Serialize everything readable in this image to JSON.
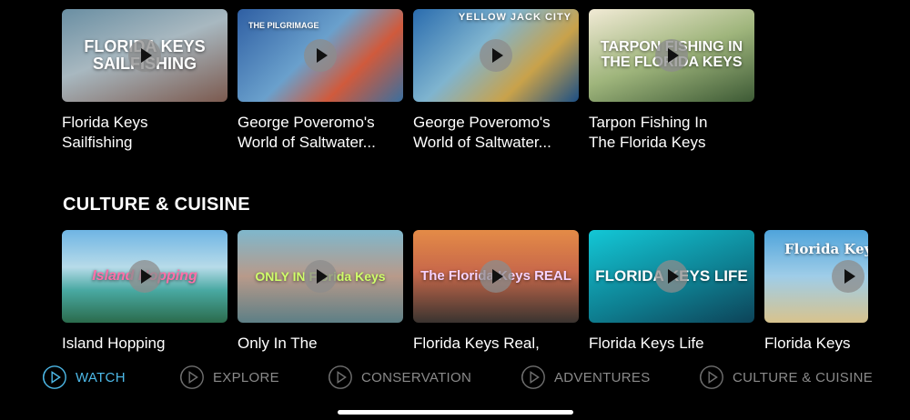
{
  "top_row": [
    {
      "title": "Florida Keys\nSailfishing",
      "thumb_text": "FLORIDA KEYS SAILFISHING"
    },
    {
      "title": "George Poveromo's\nWorld of Saltwater...",
      "thumb_text": "THE PILGRIMAGE"
    },
    {
      "title": "George Poveromo's\nWorld of Saltwater...",
      "thumb_text": "YELLOW JACK CITY"
    },
    {
      "title": "Tarpon Fishing In\nThe Florida Keys",
      "thumb_text": "TARPON FISHING IN THE FLORIDA KEYS"
    }
  ],
  "section": {
    "title": "CULTURE & CUISINE"
  },
  "bottom_row": [
    {
      "title": "Island Hopping",
      "thumb_text": "Island Hopping"
    },
    {
      "title": "Only In The",
      "thumb_text": "ONLY IN Florida Keys"
    },
    {
      "title": "Florida Keys Real,",
      "thumb_text": "The Florida Keys REAL"
    },
    {
      "title": "Florida Keys Life",
      "thumb_text": "FLORIDA KEYS LIFE"
    },
    {
      "title": "Florida Keys",
      "thumb_text": "Florida Keys"
    }
  ],
  "nav": [
    {
      "label": "WATCH",
      "icon": "play-circle-icon",
      "active": true
    },
    {
      "label": "EXPLORE",
      "icon": "play-circle-icon",
      "active": false
    },
    {
      "label": "CONSERVATION",
      "icon": "play-circle-icon",
      "active": false
    },
    {
      "label": "ADVENTURES",
      "icon": "play-circle-icon",
      "active": false
    },
    {
      "label": "CULTURE & CUISINE",
      "icon": "play-circle-icon",
      "active": false
    }
  ],
  "colors": {
    "accent": "#4db9e8",
    "inactive": "#8a8a8a",
    "background": "#000000"
  }
}
